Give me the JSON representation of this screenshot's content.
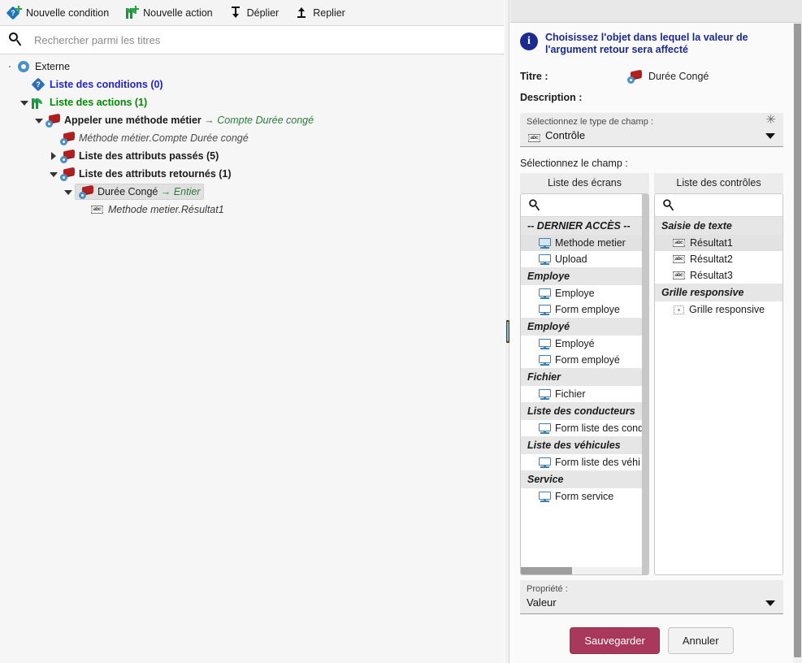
{
  "toolbar": {
    "buttons": [
      {
        "label": "Nouvelle condition",
        "icon": "new-condition-icon"
      },
      {
        "label": "Nouvelle action",
        "icon": "new-action-icon"
      },
      {
        "label": "Déplier",
        "icon": "expand-arrow-icon"
      },
      {
        "label": "Replier",
        "icon": "collapse-arrow-icon"
      }
    ]
  },
  "search": {
    "value": "",
    "placeholder": "Rechercher parmi les titres"
  },
  "tree": {
    "nodes": [
      {
        "label": "Externe",
        "icon": "gear-icon",
        "indent": 0,
        "twist": "dot",
        "color": "#1b1b1b",
        "bold": false,
        "italic": false,
        "selected": false
      },
      {
        "label": "Liste des conditions (0)",
        "icon": "question-badge-icon",
        "indent": 1,
        "twist": "none",
        "color": "#2222cc",
        "bold": true,
        "italic": false,
        "selected": false
      },
      {
        "label": "Liste des actions (1)",
        "icon": "flags-icon",
        "indent": 1,
        "twist": "open",
        "color": "#008a00",
        "bold": true,
        "italic": false,
        "selected": false
      },
      {
        "label": "Appeler une méthode métier → Compte Durée congé",
        "icon": "action-book-icon",
        "indent": 2,
        "twist": "open",
        "color": "#1b1b1b",
        "bold": true,
        "italic": false,
        "selected": false
      },
      {
        "label": "Méthode métier.Compte Durée congé",
        "icon": "gear-book-icon",
        "indent": 3,
        "twist": "none",
        "color": "#4a4a4a",
        "bold": false,
        "italic": true,
        "selected": false
      },
      {
        "label": "Liste des attributs passés (5)",
        "icon": "gear-book-icon",
        "indent": 3,
        "twist": "closed",
        "color": "#1b1b1b",
        "bold": true,
        "italic": false,
        "selected": false
      },
      {
        "label": "Liste des attributs retournés (1)",
        "icon": "gear-book-icon",
        "indent": 3,
        "twist": "open",
        "color": "#1b1b1b",
        "bold": true,
        "italic": false,
        "selected": false
      },
      {
        "label": "Durée Congé → Entier",
        "icon": "gear-book-icon",
        "indent": 4,
        "twist": "open",
        "color": "#1b1b1b",
        "bold": false,
        "italic": false,
        "selected": true
      },
      {
        "label": "Methode metier.Résultat1",
        "icon": "abc-field-icon",
        "indent": 5,
        "twist": "none",
        "color": "#3a3a3a",
        "bold": false,
        "italic": true,
        "selected": false
      }
    ]
  },
  "panel": {
    "info_message": "Choisissez l'objet dans lequel la valeur de l'argument retour sera affecté",
    "info_icon": "info-icon",
    "titre_label": "Titre :",
    "titre_value": "Durée Congé",
    "titre_icon": "gear-book-icon",
    "description_label": "Description :",
    "description_value": "",
    "type_combo": {
      "label": "Sélectionnez le type de champ :",
      "value": "Contrôle",
      "icon": "abc-field-icon",
      "required_marker": "✳",
      "caret": "chevron-down-icon"
    },
    "field_section_label": "Sélectionnez le champ :",
    "screens": {
      "header": "Liste des écrans",
      "search_value": "",
      "search_placeholder": "",
      "groups": [
        {
          "name": "-- DERNIER ACCÈS --",
          "items": [
            {
              "label": "Methode metier",
              "icon": "screen-icon",
              "selected": true
            },
            {
              "label": "Upload",
              "icon": "screen-icon",
              "selected": false
            }
          ]
        },
        {
          "name": "Employe",
          "items": [
            {
              "label": "Employe",
              "icon": "screen-icon",
              "selected": false
            },
            {
              "label": "Form employe",
              "icon": "screen-icon",
              "selected": false
            }
          ]
        },
        {
          "name": "Employé",
          "items": [
            {
              "label": "Employé",
              "icon": "screen-icon",
              "selected": false
            },
            {
              "label": "Form employé",
              "icon": "screen-icon",
              "selected": false
            }
          ]
        },
        {
          "name": "Fichier",
          "items": [
            {
              "label": "Fichier",
              "icon": "screen-icon",
              "selected": false
            }
          ]
        },
        {
          "name": "Liste des conducteurs",
          "items": [
            {
              "label": "Form liste des cond",
              "icon": "screen-icon",
              "selected": false
            }
          ]
        },
        {
          "name": "Liste des véhicules",
          "items": [
            {
              "label": "Form liste des véhi",
              "icon": "screen-icon",
              "selected": false
            }
          ]
        },
        {
          "name": "Service",
          "items": [
            {
              "label": "Form service",
              "icon": "screen-icon",
              "selected": false
            }
          ]
        }
      ]
    },
    "controls": {
      "header": "Liste des contrôles",
      "search_value": "",
      "search_placeholder": "",
      "groups": [
        {
          "name": "Saisie de texte",
          "items": [
            {
              "label": "Résultat1",
              "icon": "abc-field-icon",
              "selected": true
            },
            {
              "label": "Résultat2",
              "icon": "abc-field-icon",
              "selected": false
            },
            {
              "label": "Résultat3",
              "icon": "abc-field-icon",
              "selected": false
            }
          ]
        },
        {
          "name": "Grille responsive",
          "items": [
            {
              "label": "Grille responsive",
              "icon": "responsive-grid-icon",
              "selected": false
            }
          ]
        }
      ]
    },
    "propriete_combo": {
      "label": "Propriété :",
      "value": "Valeur",
      "caret": "chevron-down-icon"
    },
    "save_label": "Sauvegarder",
    "cancel_label": "Annuler"
  },
  "colors": {
    "accent_blue": "#2222cc",
    "accent_green": "#008a00",
    "info_blue": "#1a2a8f",
    "primary_button": "#a8385c",
    "selection": "#e2e2e2",
    "group_header": "#e6e6e6"
  }
}
